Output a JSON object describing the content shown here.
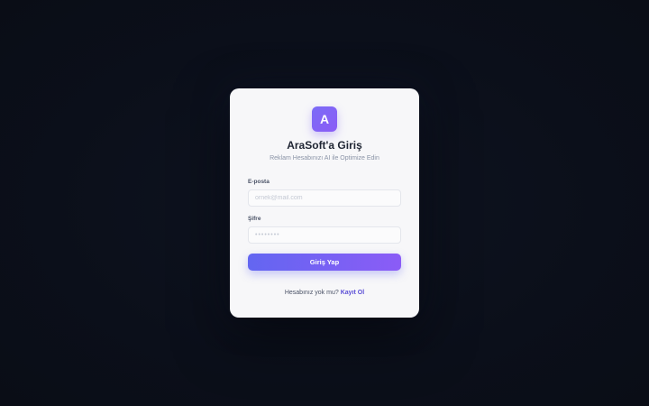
{
  "brand": {
    "logo_letter": "A",
    "accent": "#7b6cf6"
  },
  "login": {
    "title": "AraSoft'a Giriş",
    "subtitle": "Reklam Hesabınızı AI ile Optimize Edin",
    "email_label": "E-posta",
    "email_placeholder": "ornek@mail.com",
    "email_value": "",
    "password_label": "Şifre",
    "password_placeholder": "••••••••",
    "password_value": "",
    "submit_label": "Giriş Yap",
    "footer_text": "Hesabınız yok mu?",
    "register_link": "Kayıt Ol"
  }
}
